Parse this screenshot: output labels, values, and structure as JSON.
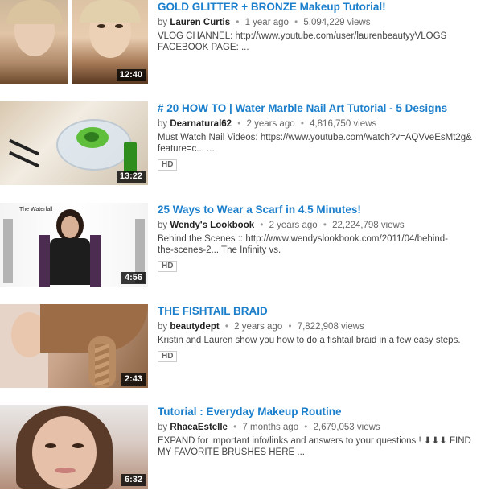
{
  "results": [
    {
      "title": "GOLD GLITTER + BRONZE Makeup Tutorial!",
      "by": "by",
      "author": "Lauren Curtis",
      "age": "1 year ago",
      "views": "5,094,229 views",
      "description_line1": "VLOG CHANNEL: http://www.youtube.com/user/laurenbeautyyVLOGS",
      "description_line2": "FACEBOOK PAGE: ...",
      "duration": "12:40",
      "hd": ""
    },
    {
      "title": "# 20 HOW TO | Water Marble Nail Art Tutorial - 5 Designs",
      "by": "by",
      "author": "Dearnatural62",
      "age": "2 years ago",
      "views": "4,816,750 views",
      "description_line1": "Must Watch Nail Videos: https://www.youtube.com/watch?v=AQVveEsMt2g&",
      "description_line2": "feature=c... ...",
      "duration": "13:22",
      "hd": "HD"
    },
    {
      "title": "25 Ways to Wear a Scarf in 4.5 Minutes!",
      "by": "by",
      "author": "Wendy's Lookbook",
      "age": "2 years ago",
      "views": "22,224,798 views",
      "description_line1": "Behind the Scenes :: http://www.wendyslookbook.com/2011/04/behind-",
      "description_line2": "the-scenes-2... The Infinity vs.",
      "duration": "4:56",
      "hd": "HD",
      "thumb_caption": "The Waterfall"
    },
    {
      "title": "THE FISHTAIL BRAID",
      "by": "by",
      "author": "beautydept",
      "age": "2 years ago",
      "views": "7,822,908 views",
      "description_line1": "Kristin and Lauren show you how to do a fishtail braid in a few easy steps.",
      "description_line2": "",
      "duration": "2:43",
      "hd": "HD"
    },
    {
      "title": "Tutorial : Everyday Makeup Routine",
      "by": "by",
      "author": "RhaeaEstelle",
      "age": "7 months ago",
      "views": "2,679,053 views",
      "description_line1": "EXPAND for important info/links and answers to your questions ! ⬇⬇⬇ FIND",
      "description_line2": "MY FAVORITE BRUSHES HERE ...",
      "duration": "6:32",
      "hd": ""
    }
  ],
  "colors": {
    "title_link": "#1b7fcc",
    "meta_text": "#666666",
    "author_text": "#222222"
  }
}
